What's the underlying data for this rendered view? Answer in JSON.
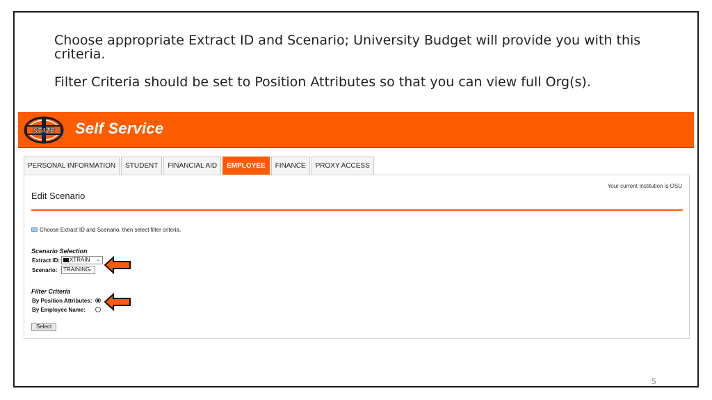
{
  "slide": {
    "paragraphs": [
      "Choose appropriate Extract ID and Scenario; University Budget will provide you with this criteria.",
      "Filter Criteria should be set to Position Attributes so that you can view full Org(s)."
    ],
    "page_number": "5"
  },
  "banner": {
    "logo_text": "STATE",
    "title": "Self Service",
    "color": "#fe5c00"
  },
  "tabs": [
    {
      "label": "PERSONAL INFORMATION",
      "active": false
    },
    {
      "label": "STUDENT",
      "active": false
    },
    {
      "label": "FINANCIAL AID",
      "active": false
    },
    {
      "label": "EMPLOYEE",
      "active": true
    },
    {
      "label": "FINANCE",
      "active": false
    },
    {
      "label": "PROXY ACCESS",
      "active": false
    }
  ],
  "panel": {
    "institution_text": "Your current Institution is OSU",
    "page_title": "Edit Scenario",
    "info_text": "Choose Extract ID and Scenario, then select filter criteria.",
    "scenario_selection": {
      "heading": "Scenario Selection",
      "extract_label": "Extract ID:",
      "extract_value": "XTRAIN",
      "scenario_label": "Scenario:",
      "scenario_value": "TRAINING"
    },
    "filter_criteria": {
      "heading": "Filter Criteria",
      "by_position_label": "By Position Attributes:",
      "by_position_checked": true,
      "by_employee_label": "By Employee Name:",
      "by_employee_checked": false
    },
    "select_button_label": "Select"
  },
  "icons": {
    "arrow": "left-arrow-icon",
    "info": "info-flag-icon",
    "caret": "chevron-down-icon"
  }
}
